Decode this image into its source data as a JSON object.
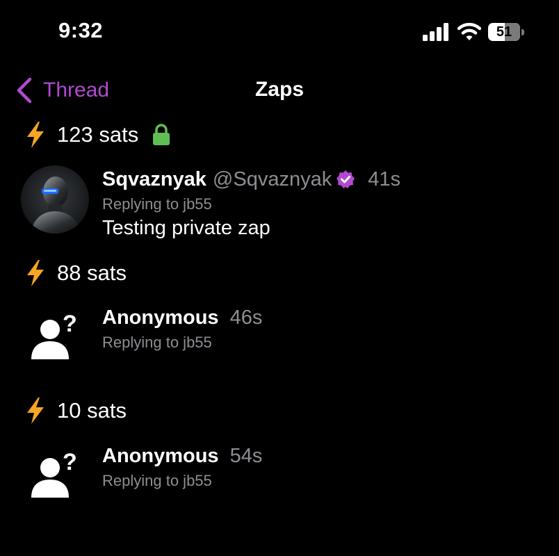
{
  "status_bar": {
    "time": "9:32",
    "battery_level": "51",
    "icons": [
      "cellular-signal-icon",
      "wifi-icon",
      "battery-icon"
    ]
  },
  "nav": {
    "back_label": "Thread",
    "title": "Zaps",
    "accent_color": "#b14ad0"
  },
  "zaps": [
    {
      "amount": "123 sats",
      "private": true,
      "display_name": "Sqvaznyak",
      "handle": "@Sqvaznyak",
      "verified": true,
      "age": "41s",
      "replying": "Replying to jb55",
      "message": "Testing private zap"
    },
    {
      "amount": "88 sats",
      "private": false,
      "display_name": "Anonymous",
      "age": "46s",
      "replying": "Replying to jb55"
    },
    {
      "amount": "10 sats",
      "private": false,
      "display_name": "Anonymous",
      "age": "54s",
      "replying": "Replying to jb55"
    }
  ],
  "colors": {
    "background": "#000000",
    "bolt": "#f5a623",
    "lock": "#5fbf55",
    "verified": "#b14ad0",
    "secondary_text": "#8e8e93"
  }
}
